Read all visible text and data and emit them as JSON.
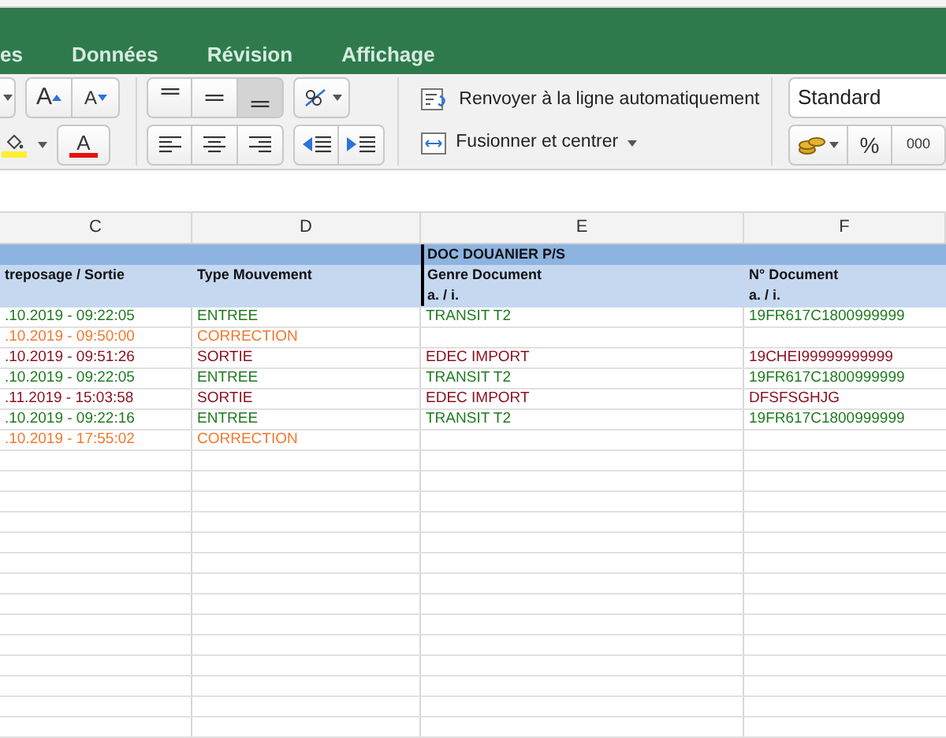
{
  "ribbon_tabs": [
    {
      "label": "es",
      "selected": false
    },
    {
      "label": "Données",
      "selected": false
    },
    {
      "label": "Révision",
      "selected": false
    },
    {
      "label": "Affichage",
      "selected": false
    }
  ],
  "font_tools": {
    "grow": "A",
    "shrink": "A",
    "font_color": "A"
  },
  "alignment": {
    "vertical": [
      {
        "kind": "top",
        "selected": false
      },
      {
        "kind": "middle",
        "selected": false
      },
      {
        "kind": "bottom",
        "selected": true
      }
    ]
  },
  "wrap_text": "Renvoyer à la ligne automatiquement",
  "merge_center": "Fusionner et centrer",
  "number_format": {
    "value": "Standard",
    "percent": "%",
    "thousands": "000"
  },
  "columns": [
    "C",
    "D",
    "E",
    "F"
  ],
  "group_header": "DOC DOUANIER P/S",
  "headers": [
    {
      "title": "treposage / Sortie"
    },
    {
      "title": "Type Mouvement"
    },
    {
      "title": "Genre Document",
      "sub": "a. / i."
    },
    {
      "title": "N° Document",
      "sub": "a. / i."
    }
  ],
  "rows": [
    {
      "kind": "entree",
      "date": ".10.2019 - 09:22:05",
      "type": "ENTREE",
      "genre": "TRANSIT T2",
      "numero": "19FR617C1800999999"
    },
    {
      "kind": "correction",
      "date": ".10.2019 - 09:50:00",
      "type": "CORRECTION"
    },
    {
      "kind": "sortie",
      "date": ".10.2019 - 09:51:26",
      "type": "SORTIE",
      "genre": "EDEC IMPORT",
      "numero": "19CHEI99999999999"
    },
    {
      "kind": "entree",
      "date": ".10.2019 - 09:22:05",
      "type": "ENTREE",
      "genre": "TRANSIT T2",
      "numero": "19FR617C1800999999"
    },
    {
      "kind": "sortie",
      "date": ".11.2019 - 15:03:58",
      "type": "SORTIE",
      "genre": "EDEC IMPORT",
      "numero": "DFSFSGHJG"
    },
    {
      "kind": "entree",
      "date": ".10.2019 - 09:22:16",
      "type": "ENTREE",
      "genre": "TRANSIT T2",
      "numero": "19FR617C1800999999"
    },
    {
      "kind": "correction",
      "date": ".10.2019 - 17:55:02",
      "type": "CORRECTION"
    }
  ]
}
